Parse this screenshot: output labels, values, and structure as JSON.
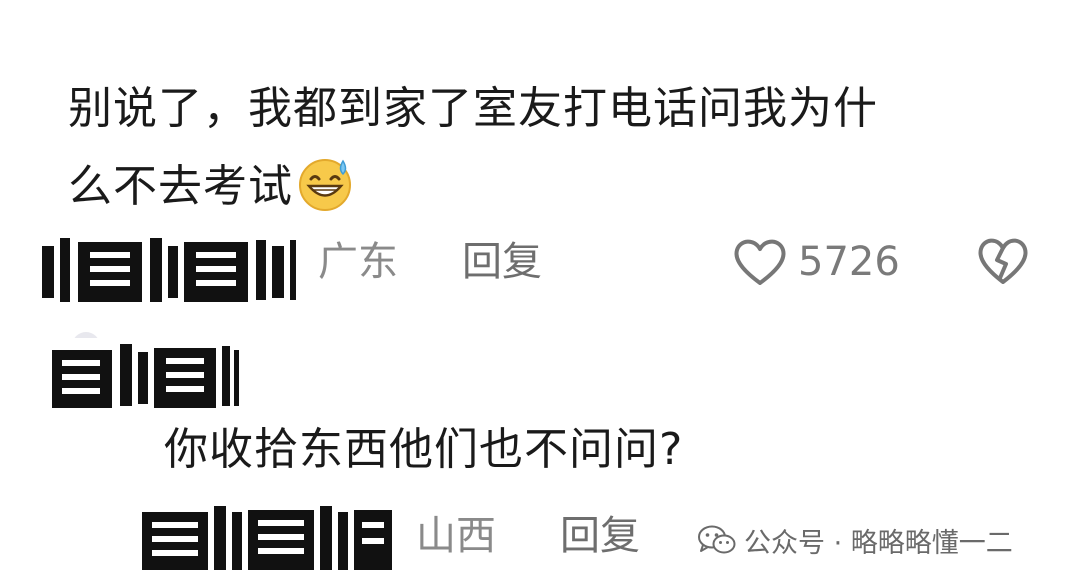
{
  "comment": {
    "text_line1": "别说了，我都到家了室友打电话问我为什",
    "text_line2": "么不去考试",
    "emoji": "sweat-smile-emoji",
    "location": "广东",
    "reply_label": "回复",
    "like_count": "5726",
    "like_icon": "heart-outline-icon",
    "dislike_icon": "broken-heart-icon"
  },
  "reply": {
    "text": "你收拾东西他们也不问问?",
    "location": "山西",
    "reply_label": "回复"
  },
  "watermark": {
    "text": "公众号 · 略略略懂一二",
    "icon": "wechat-icon"
  },
  "colors": {
    "text": "#1a1a1a",
    "meta": "#8a8a8a",
    "icon": "#777777",
    "background": "#ffffff"
  }
}
